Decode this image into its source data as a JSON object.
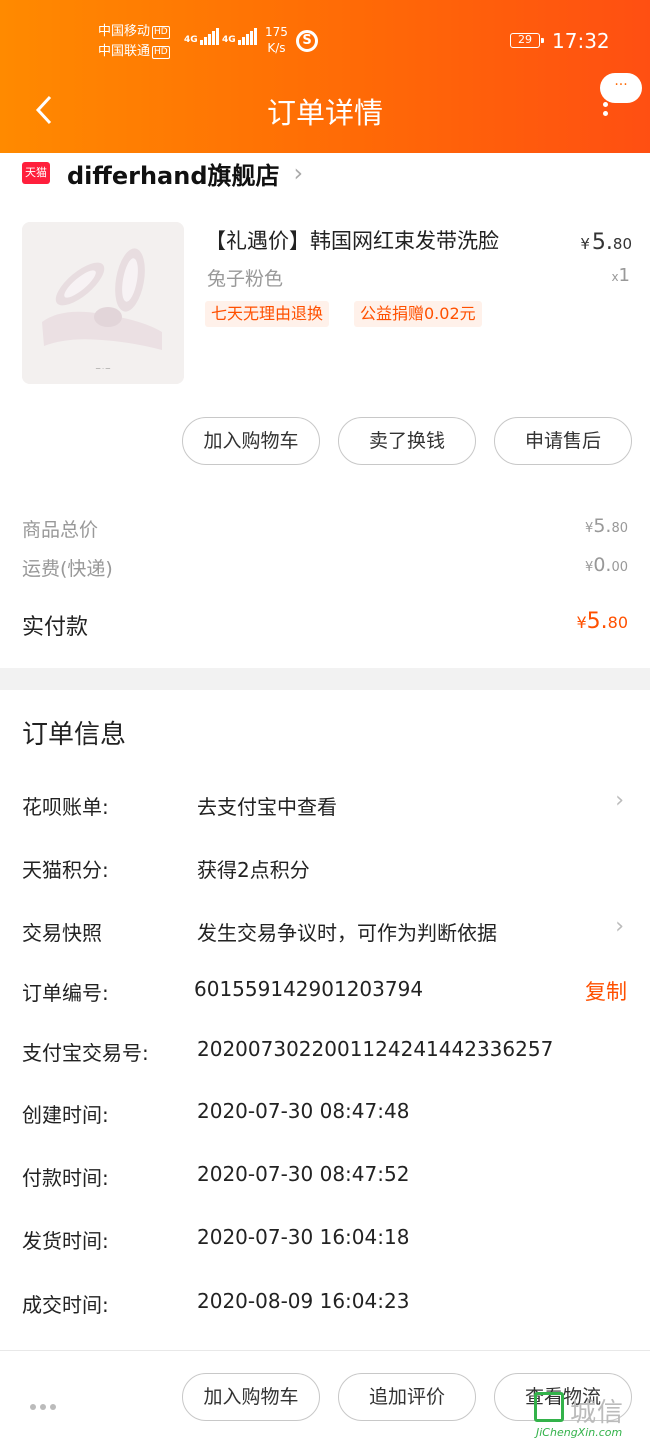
{
  "status_bar": {
    "carrier1": "中国移动",
    "carrier2": "中国联通",
    "hd": "HD",
    "net1": "4G",
    "net2": "4G",
    "speed_value": "175",
    "speed_unit": "K/s",
    "speed_icon": "S",
    "battery": "29",
    "time": "17:32"
  },
  "header": {
    "title": "订单详情",
    "more_bubble": "···"
  },
  "store": {
    "badge": "天猫",
    "name": "differhand旗舰店"
  },
  "product": {
    "title": "【礼遇价】韩国网红束发带洗脸",
    "variant": "兔子粉色",
    "price_yen": "¥",
    "price_int": "5.",
    "price_dec": "80",
    "qty_prefix": "x",
    "qty": "1",
    "tags": [
      "七天无理由退换",
      "公益捐赠0.02元"
    ],
    "image_icon": "bunny-ear-headband-image"
  },
  "product_actions": [
    "加入购物车",
    "卖了换钱",
    "申请售后"
  ],
  "summary": {
    "goods_label": "商品总价",
    "goods_int": "5.",
    "goods_dec": "80",
    "shipping_label": "运费(快递)",
    "shipping_int": "0.",
    "shipping_dec": "00",
    "paid_label": "实付款",
    "paid_int": "5.",
    "paid_dec": "80",
    "yen": "¥"
  },
  "order_info": {
    "title": "订单信息",
    "rows": [
      {
        "label": "花呗账单:",
        "value": "去支付宝中查看"
      },
      {
        "label": "天猫积分:",
        "value": "获得2点积分"
      },
      {
        "label": "交易快照",
        "value": "发生交易争议时，可作为判断依据"
      },
      {
        "label": "订单编号:",
        "value": "601559142901203794"
      },
      {
        "label": "支付宝交易号:",
        "value": "2020073022001124241442336257"
      },
      {
        "label": "创建时间:",
        "value": "2020-07-30 08:47:48"
      },
      {
        "label": "付款时间:",
        "value": "2020-07-30 08:47:52"
      },
      {
        "label": "发货时间:",
        "value": "2020-07-30 16:04:18"
      },
      {
        "label": "成交时间:",
        "value": "2020-08-09 16:04:23"
      }
    ],
    "copy_label": "复制"
  },
  "bottom_actions": [
    "加入购物车",
    "追加评价",
    "查看物流"
  ],
  "watermark": {
    "text": "城信",
    "url": "JiChengXin.com"
  },
  "colors": {
    "header_start": "#ff8a00",
    "header_end": "#ff4f12",
    "accent": "#ff5000",
    "tmall_red": "#ff1f3c"
  }
}
